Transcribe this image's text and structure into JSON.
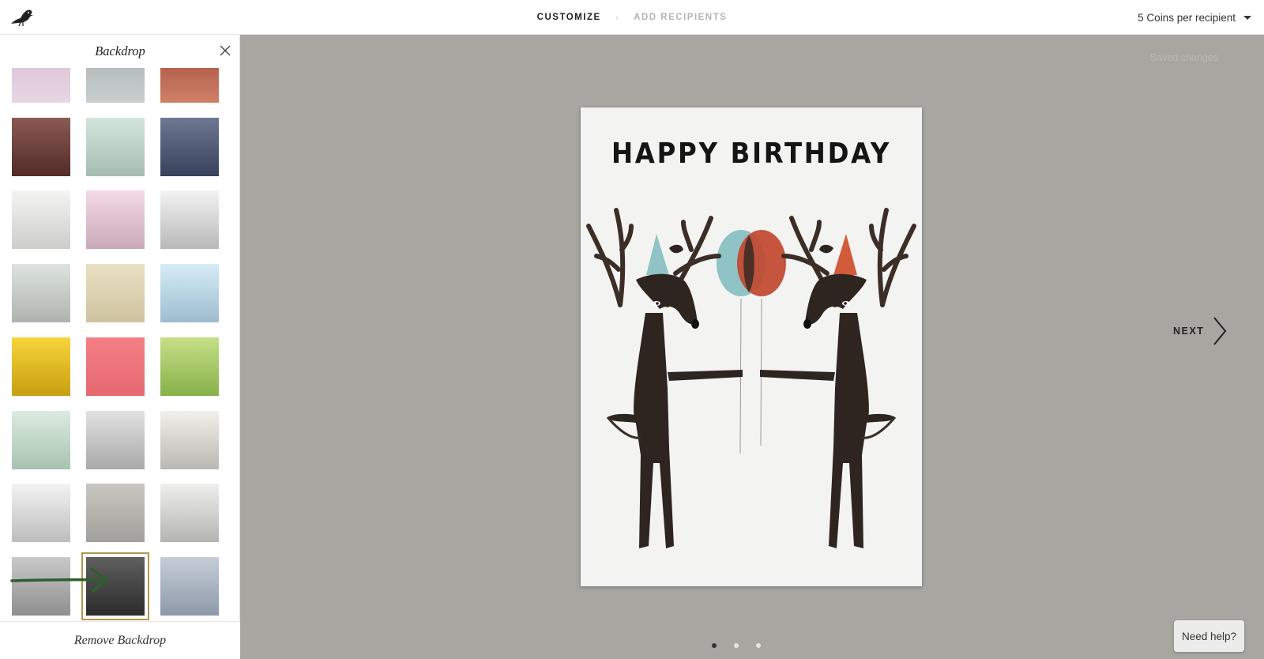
{
  "nav": {
    "step1": "CUSTOMIZE",
    "step2": "ADD RECIPIENTS",
    "coins": "5 Coins per recipient"
  },
  "panel": {
    "title": "Backdrop",
    "remove_label": "Remove Backdrop",
    "selected_index": 22,
    "swatches": [
      {
        "name": "backdrop-1",
        "colors": [
          "#d8bfd3",
          "#e8d6e3"
        ]
      },
      {
        "name": "backdrop-2",
        "colors": [
          "#aab1b1",
          "#c9cfce"
        ]
      },
      {
        "name": "backdrop-3",
        "colors": [
          "#a44e3b",
          "#cf8067"
        ]
      },
      {
        "name": "backdrop-4",
        "colors": [
          "#8a5a54",
          "#522a27"
        ]
      },
      {
        "name": "backdrop-5",
        "colors": [
          "#d4e6dc",
          "#a6bcb1"
        ]
      },
      {
        "name": "backdrop-6",
        "colors": [
          "#6d7893",
          "#39415a"
        ]
      },
      {
        "name": "backdrop-7",
        "colors": [
          "#f4f4f2",
          "#cdcdcb"
        ]
      },
      {
        "name": "backdrop-8",
        "colors": [
          "#f4dbe4",
          "#c9a9b8"
        ]
      },
      {
        "name": "backdrop-9",
        "colors": [
          "#f3f3f3",
          "#b8b8b8"
        ]
      },
      {
        "name": "backdrop-10",
        "colors": [
          "#dde3de",
          "#aeb3ae"
        ]
      },
      {
        "name": "backdrop-11",
        "colors": [
          "#e9e0c3",
          "#cfc39f"
        ]
      },
      {
        "name": "backdrop-12",
        "colors": [
          "#d6ecf6",
          "#9ebccf"
        ]
      },
      {
        "name": "backdrop-13",
        "colors": [
          "#f8d53a",
          "#c79f10"
        ]
      },
      {
        "name": "backdrop-14",
        "colors": [
          "#f38085",
          "#e66870"
        ]
      },
      {
        "name": "backdrop-15",
        "colors": [
          "#c5df86",
          "#88b14a"
        ]
      },
      {
        "name": "backdrop-16",
        "colors": [
          "#dcece0",
          "#a6c3b0"
        ]
      },
      {
        "name": "backdrop-17",
        "colors": [
          "#e2e2e2",
          "#a9a9a9"
        ]
      },
      {
        "name": "backdrop-18",
        "colors": [
          "#f1f0ea",
          "#b9b8b2"
        ]
      },
      {
        "name": "backdrop-19",
        "colors": [
          "#f3f3f3",
          "#bdbdbd"
        ]
      },
      {
        "name": "backdrop-20",
        "colors": [
          "#c9c7c1",
          "#a19f9a"
        ]
      },
      {
        "name": "backdrop-21",
        "colors": [
          "#efefed",
          "#b4b4b1"
        ]
      },
      {
        "name": "backdrop-22",
        "colors": [
          "#c9c9c9",
          "#8f8f8f"
        ]
      },
      {
        "name": "backdrop-23",
        "colors": [
          "#5f5f5f",
          "#2c2c2c"
        ]
      },
      {
        "name": "backdrop-24",
        "colors": [
          "#c6cdd7",
          "#8e99a9"
        ]
      }
    ]
  },
  "canvas": {
    "saved_text": "Saved changes",
    "card_title": "HAPPY BIRTHDAY",
    "next_label": "NEXT",
    "help_label": "Need help?",
    "page_count": 3,
    "current_page": 1,
    "colors": {
      "background": "#a7a6a1",
      "deer": "#2e2520",
      "hat_left": "#8fc3c5",
      "hat_right": "#d25b3c",
      "balloon_left": "#8fc3c5",
      "balloon_right": "#c2482f",
      "arrow": "#2f5e2f",
      "selected_outline": "#b0974b"
    }
  }
}
